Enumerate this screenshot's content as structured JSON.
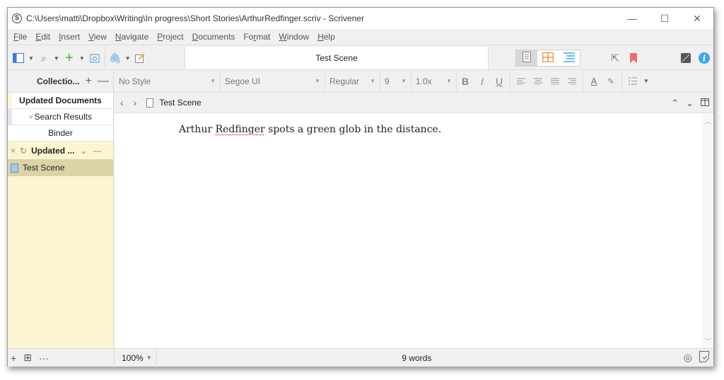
{
  "window": {
    "title": "C:\\Users\\matti\\Dropbox\\Writing\\In progress\\Short Stories\\ArthurRedfinger.scriv - Scrivener",
    "controls": {
      "minimize": "—",
      "maximize": "☐",
      "close": "✕"
    }
  },
  "menu": {
    "items": [
      {
        "label": "File",
        "accel": "F"
      },
      {
        "label": "Edit",
        "accel": "E"
      },
      {
        "label": "Insert",
        "accel": "I"
      },
      {
        "label": "View",
        "accel": "V"
      },
      {
        "label": "Navigate",
        "accel": "N"
      },
      {
        "label": "Project",
        "accel": "P"
      },
      {
        "label": "Documents",
        "accel": "D"
      },
      {
        "label": "Format",
        "accel": "r"
      },
      {
        "label": "Window",
        "accel": "W"
      },
      {
        "label": "Help",
        "accel": "H"
      }
    ]
  },
  "toolbar": {
    "document_title": "Test Scene",
    "icons": [
      "binder-toggle-icon",
      "search-icon",
      "add-icon",
      "trash-icon",
      "attachment-icon",
      "edit-note-icon"
    ],
    "view_modes": [
      "scrivenings-icon",
      "corkboard-icon",
      "outliner-icon"
    ],
    "right_icons": [
      "share-icon",
      "bookmark-icon",
      "inspector-image-icon",
      "info-icon"
    ],
    "colors": {
      "add": "#3cb14a",
      "corkboard": "#f0924b",
      "outliner": "#3aa7e8",
      "bookmark": "#f26b6b",
      "info": "#3aa7e8"
    }
  },
  "left_panel": {
    "header": "Collectio...",
    "header_add": "+",
    "header_remove": "—",
    "tabs": [
      {
        "label": "Updated Documents"
      },
      {
        "label": "Search Results",
        "icon": "search-icon"
      },
      {
        "label": "Binder"
      }
    ],
    "collection_bar": {
      "close": "×",
      "refresh": "↻",
      "name": "Updated ...",
      "chevron": "⌄",
      "minus": "—"
    },
    "items": [
      {
        "label": "Test Scene"
      }
    ]
  },
  "format_bar": {
    "style": "No Style",
    "font": "Segoe UI",
    "weight": "Regular",
    "size": "9",
    "line_spacing": "1.0x",
    "buttons": {
      "bold": "B",
      "italic": "I",
      "underline": "U"
    }
  },
  "nav_bar": {
    "back": "‹",
    "forward": "›",
    "document": "Test Scene",
    "up": "⌃",
    "down": "⌄"
  },
  "editor": {
    "text_before": "Arthur ",
    "misspelled": "Redfinger",
    "text_after": " spots a green glob in the distance."
  },
  "footer": {
    "add": "+",
    "add_folder": "⊞",
    "more": "···",
    "zoom": "100%",
    "word_count": "9 words"
  }
}
